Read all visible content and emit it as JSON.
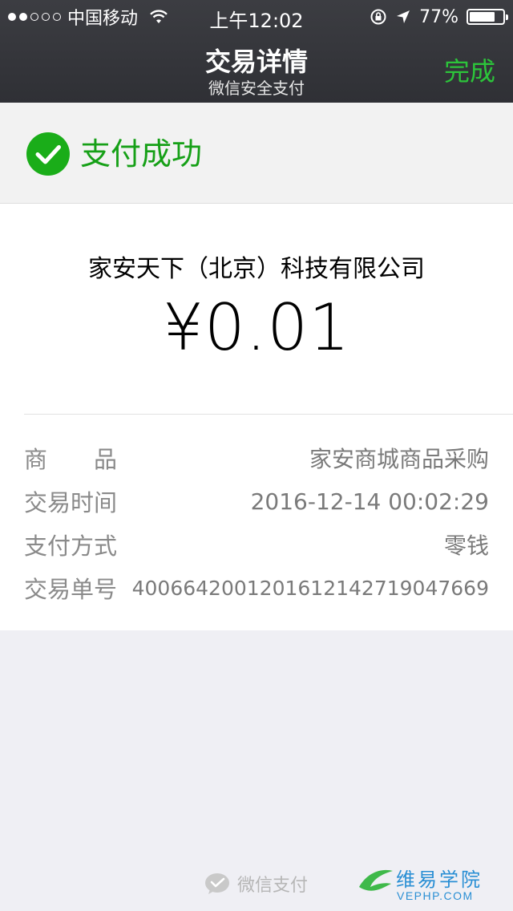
{
  "status_bar": {
    "carrier": "中国移动",
    "time": "上午12:02",
    "battery": "77%",
    "battery_level": 0.77
  },
  "nav": {
    "title": "交易详情",
    "subtitle": "微信安全支付",
    "done_label": "完成"
  },
  "success": {
    "message": "支付成功",
    "color": "#16a017"
  },
  "payment": {
    "merchant": "家安天下（北京）科技有限公司",
    "amount": "¥0.01"
  },
  "details": {
    "goods_label_1": "商",
    "goods_label_2": "品",
    "goods_value": "家安商城商品采购",
    "time_label": "交易时间",
    "time_value": "2016-12-14 00:02:29",
    "method_label": "支付方式",
    "method_value": "零钱",
    "order_label": "交易单号",
    "order_value": "4006642001201612142719047669"
  },
  "footer": {
    "brand": "微信支付"
  },
  "watermark": {
    "name": "维易学院",
    "site": "VEPHP.COM"
  }
}
